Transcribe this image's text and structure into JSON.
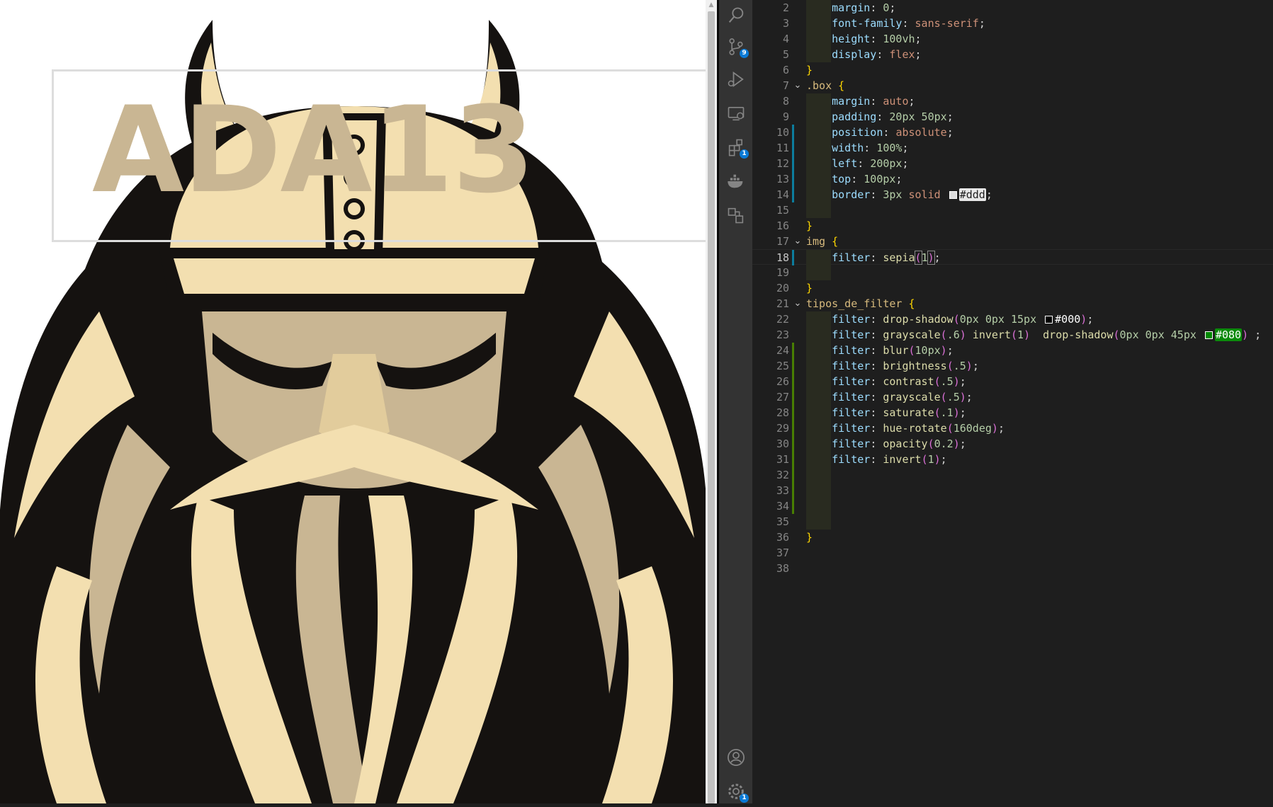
{
  "preview": {
    "logo_text": "ADA13",
    "image_subject": "viking-mascot-illustration",
    "colors": {
      "outline": "#151210",
      "cream": "#f3dfb0",
      "tan": "#c9b693",
      "shadow": "#a89878",
      "box_border": "#dddddd"
    }
  },
  "activity_bar": {
    "items": [
      {
        "icon": "search-icon",
        "badge": ""
      },
      {
        "icon": "source-control-icon",
        "badge": "9"
      },
      {
        "icon": "run-debug-icon",
        "badge": ""
      },
      {
        "icon": "remote-explorer-icon",
        "badge": ""
      },
      {
        "icon": "extensions-icon",
        "badge": "1"
      },
      {
        "icon": "docker-icon",
        "badge": ""
      },
      {
        "icon": "live-share-icon",
        "badge": ""
      }
    ],
    "bottom": [
      {
        "icon": "accounts-icon",
        "badge": ""
      },
      {
        "icon": "manage-gear-icon",
        "badge": "1"
      }
    ]
  },
  "editor": {
    "current_line": "18",
    "lines": [
      {
        "n": "2",
        "tokens": [
          [
            "prop",
            "    margin"
          ],
          [
            "punct",
            ": "
          ],
          [
            "num",
            "0"
          ],
          [
            "punct",
            ";"
          ]
        ]
      },
      {
        "n": "3",
        "tokens": [
          [
            "prop",
            "    font-family"
          ],
          [
            "punct",
            ": "
          ],
          [
            "val",
            "sans-serif"
          ],
          [
            "punct",
            ";"
          ]
        ]
      },
      {
        "n": "4",
        "tokens": [
          [
            "prop",
            "    height"
          ],
          [
            "punct",
            ": "
          ],
          [
            "num",
            "100vh"
          ],
          [
            "punct",
            ";"
          ]
        ]
      },
      {
        "n": "5",
        "tokens": [
          [
            "prop",
            "    display"
          ],
          [
            "punct",
            ": "
          ],
          [
            "val",
            "flex"
          ],
          [
            "punct",
            ";"
          ]
        ]
      },
      {
        "n": "6",
        "tokens": [
          [
            "brace",
            "}"
          ]
        ]
      },
      {
        "n": "7",
        "fold": true,
        "tokens": [
          [
            "selector",
            ".box"
          ],
          [
            "punct",
            " "
          ],
          [
            "brace",
            "{"
          ]
        ]
      },
      {
        "n": "8",
        "tokens": [
          [
            "prop",
            "    margin"
          ],
          [
            "punct",
            ": "
          ],
          [
            "val",
            "auto"
          ],
          [
            "punct",
            ";"
          ]
        ]
      },
      {
        "n": "9",
        "tokens": [
          [
            "prop",
            "    padding"
          ],
          [
            "punct",
            ": "
          ],
          [
            "num",
            "20px 50px"
          ],
          [
            "punct",
            ";"
          ]
        ]
      },
      {
        "n": "10",
        "tokens": [
          [
            "prop",
            "    position"
          ],
          [
            "punct",
            ": "
          ],
          [
            "val",
            "absolute"
          ],
          [
            "punct",
            ";"
          ]
        ]
      },
      {
        "n": "11",
        "tokens": [
          [
            "prop",
            "    width"
          ],
          [
            "punct",
            ": "
          ],
          [
            "num",
            "100%"
          ],
          [
            "punct",
            ";"
          ]
        ]
      },
      {
        "n": "12",
        "tokens": [
          [
            "prop",
            "    left"
          ],
          [
            "punct",
            ": "
          ],
          [
            "num",
            "200px"
          ],
          [
            "punct",
            ";"
          ]
        ]
      },
      {
        "n": "13",
        "tokens": [
          [
            "prop",
            "    top"
          ],
          [
            "punct",
            ": "
          ],
          [
            "num",
            "100px"
          ],
          [
            "punct",
            ";"
          ]
        ]
      },
      {
        "n": "14",
        "tokens": [
          [
            "prop",
            "    border"
          ],
          [
            "punct",
            ": "
          ],
          [
            "num",
            "3px "
          ],
          [
            "val",
            "solid "
          ],
          [
            "swatch",
            "#dddddd"
          ],
          [
            "hlwhite",
            "#ddd"
          ],
          [
            "punct",
            ";"
          ]
        ]
      },
      {
        "n": "15",
        "tokens": []
      },
      {
        "n": "16",
        "tokens": [
          [
            "brace",
            "}"
          ]
        ]
      },
      {
        "n": "17",
        "fold": true,
        "tokens": [
          [
            "selector",
            "img"
          ],
          [
            "punct",
            " "
          ],
          [
            "brace",
            "{"
          ]
        ]
      },
      {
        "n": "18",
        "tokens": [
          [
            "prop",
            "    filter"
          ],
          [
            "punct",
            ": "
          ],
          [
            "fn",
            "sepia"
          ],
          [
            "cursor",
            "("
          ],
          [
            "num",
            "1"
          ],
          [
            "cursor",
            ")"
          ],
          [
            "punct",
            ";"
          ]
        ]
      },
      {
        "n": "19",
        "tokens": []
      },
      {
        "n": "20",
        "tokens": [
          [
            "brace",
            "}"
          ]
        ]
      },
      {
        "n": "21",
        "fold": true,
        "tokens": [
          [
            "selector",
            "tipos_de_filter"
          ],
          [
            "punct",
            " "
          ],
          [
            "brace",
            "{"
          ]
        ]
      },
      {
        "n": "22",
        "tokens": [
          [
            "prop",
            "    filter"
          ],
          [
            "punct",
            ": "
          ],
          [
            "fn",
            "drop-shadow"
          ],
          [
            "paren",
            "("
          ],
          [
            "num",
            "0px 0px 15px "
          ],
          [
            "swatch",
            "#000000"
          ],
          [
            "hlblack",
            "#000"
          ],
          [
            "paren",
            ")"
          ],
          [
            "punct",
            ";"
          ]
        ]
      },
      {
        "n": "23",
        "tokens": [
          [
            "prop",
            "    filter"
          ],
          [
            "punct",
            ": "
          ],
          [
            "fn",
            "grayscale"
          ],
          [
            "paren",
            "("
          ],
          [
            "num",
            ".6"
          ],
          [
            "paren",
            ")"
          ],
          [
            "punct",
            " "
          ],
          [
            "fn",
            "invert"
          ],
          [
            "paren",
            "("
          ],
          [
            "num",
            "1"
          ],
          [
            "paren",
            ")"
          ],
          [
            "punct",
            "  "
          ],
          [
            "fn",
            "drop-shadow"
          ],
          [
            "paren",
            "("
          ],
          [
            "num",
            "0px 0px 45px "
          ],
          [
            "swatch",
            "#008800"
          ],
          [
            "hlgreen",
            "#080"
          ],
          [
            "paren",
            ")"
          ],
          [
            "punct",
            " ;"
          ]
        ]
      },
      {
        "n": "24",
        "tokens": [
          [
            "prop",
            "    filter"
          ],
          [
            "punct",
            ": "
          ],
          [
            "fn",
            "blur"
          ],
          [
            "paren",
            "("
          ],
          [
            "num",
            "10px"
          ],
          [
            "paren",
            ")"
          ],
          [
            "punct",
            ";"
          ]
        ]
      },
      {
        "n": "25",
        "tokens": [
          [
            "prop",
            "    filter"
          ],
          [
            "punct",
            ": "
          ],
          [
            "fn",
            "brightness"
          ],
          [
            "paren",
            "("
          ],
          [
            "num",
            ".5"
          ],
          [
            "paren",
            ")"
          ],
          [
            "punct",
            ";"
          ]
        ]
      },
      {
        "n": "26",
        "tokens": [
          [
            "prop",
            "    filter"
          ],
          [
            "punct",
            ": "
          ],
          [
            "fn",
            "contrast"
          ],
          [
            "paren",
            "("
          ],
          [
            "num",
            ".5"
          ],
          [
            "paren",
            ")"
          ],
          [
            "punct",
            ";"
          ]
        ]
      },
      {
        "n": "27",
        "tokens": [
          [
            "prop",
            "    filter"
          ],
          [
            "punct",
            ": "
          ],
          [
            "fn",
            "grayscale"
          ],
          [
            "paren",
            "("
          ],
          [
            "num",
            ".5"
          ],
          [
            "paren",
            ")"
          ],
          [
            "punct",
            ";"
          ]
        ]
      },
      {
        "n": "28",
        "tokens": [
          [
            "prop",
            "    filter"
          ],
          [
            "punct",
            ": "
          ],
          [
            "fn",
            "saturate"
          ],
          [
            "paren",
            "("
          ],
          [
            "num",
            ".1"
          ],
          [
            "paren",
            ")"
          ],
          [
            "punct",
            ";"
          ]
        ]
      },
      {
        "n": "29",
        "tokens": [
          [
            "prop",
            "    filter"
          ],
          [
            "punct",
            ": "
          ],
          [
            "fn",
            "hue-rotate"
          ],
          [
            "paren",
            "("
          ],
          [
            "num",
            "160deg"
          ],
          [
            "paren",
            ")"
          ],
          [
            "punct",
            ";"
          ]
        ]
      },
      {
        "n": "30",
        "tokens": [
          [
            "prop",
            "    filter"
          ],
          [
            "punct",
            ": "
          ],
          [
            "fn",
            "opacity"
          ],
          [
            "paren",
            "("
          ],
          [
            "num",
            "0.2"
          ],
          [
            "paren",
            ")"
          ],
          [
            "punct",
            ";"
          ]
        ]
      },
      {
        "n": "31",
        "tokens": [
          [
            "prop",
            "    filter"
          ],
          [
            "punct",
            ": "
          ],
          [
            "fn",
            "invert"
          ],
          [
            "paren",
            "("
          ],
          [
            "num",
            "1"
          ],
          [
            "paren",
            ")"
          ],
          [
            "punct",
            ";"
          ]
        ]
      },
      {
        "n": "32",
        "tokens": []
      },
      {
        "n": "33",
        "tokens": []
      },
      {
        "n": "34",
        "tokens": []
      },
      {
        "n": "35",
        "tokens": []
      },
      {
        "n": "36",
        "tokens": [
          [
            "brace",
            "}"
          ]
        ]
      },
      {
        "n": "37",
        "tokens": []
      },
      {
        "n": "38",
        "tokens": []
      }
    ]
  }
}
